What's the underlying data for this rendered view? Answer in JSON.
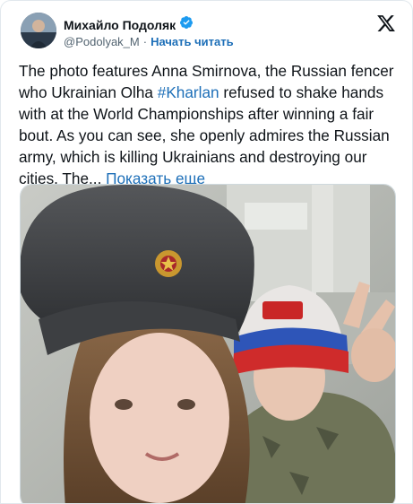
{
  "author": {
    "name": "Михайло Подоляк",
    "handle": "@Podolyak_M",
    "separator": "·",
    "follow_label": "Начать читать"
  },
  "tweet": {
    "text_before": "The photo features Anna Smirnova, the Russian fencer who Ukrainian Olha ",
    "hashtag": "#Kharlan",
    "text_after": " refused to shake hands with at the World Championships after winning a fair bout. As you can see, she openly admires the Russian army, which is killing Ukrainians and destroying our cities. The... ",
    "show_more": "Показать еще"
  },
  "icons": {
    "verified": "verified-badge-icon",
    "platform": "x-logo-icon"
  },
  "colors": {
    "accent": "#1d9bf0",
    "link": "#1d6fb8",
    "text": "#0f1419",
    "secondary": "#536471"
  }
}
